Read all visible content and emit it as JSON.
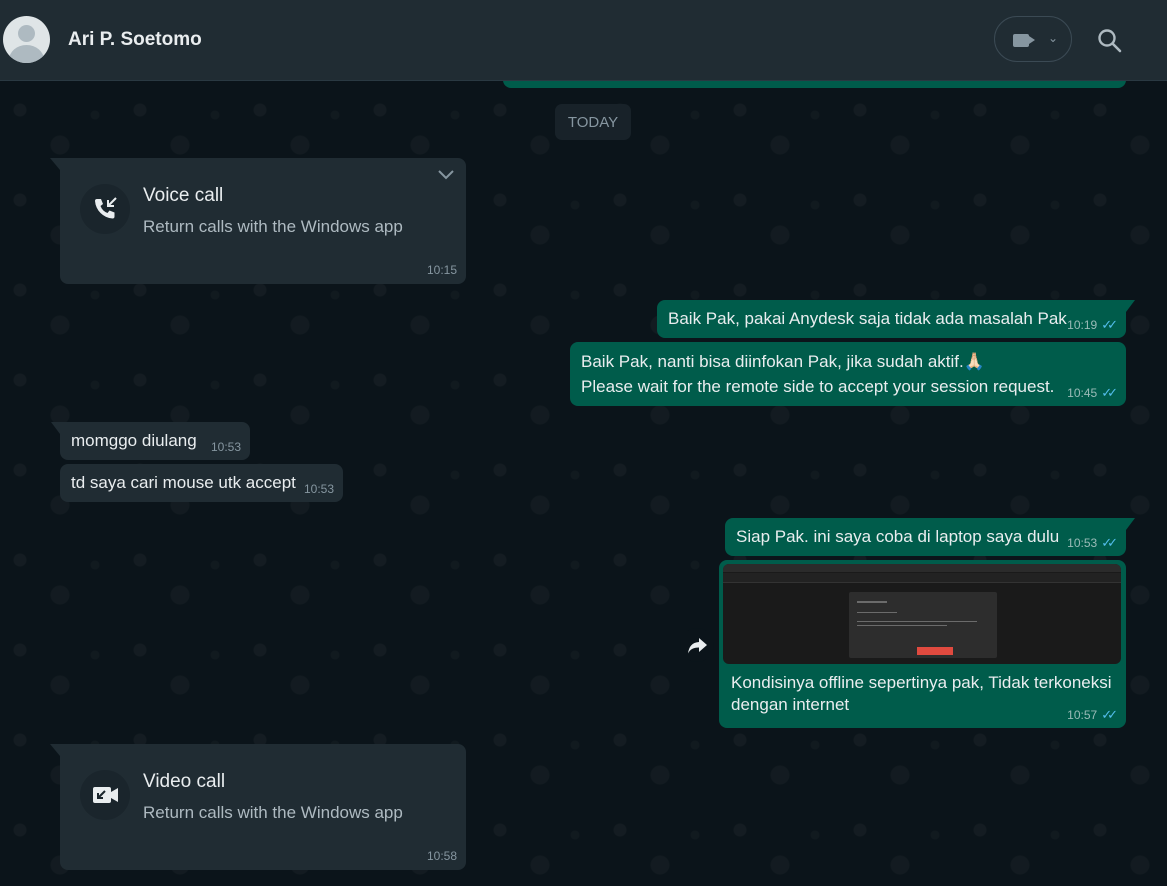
{
  "header": {
    "contact_name": "Ari P. Soetomo",
    "icons": [
      "avatar-icon",
      "video-camera-icon",
      "chevron-down-icon",
      "search-icon"
    ]
  },
  "date_chip": "TODAY",
  "voice_call": {
    "title": "Voice call",
    "subtitle": "Return calls with the Windows app",
    "time": "10:15"
  },
  "messages": [
    {
      "dir": "out",
      "lines": [
        "Baik Pak, pakai Anydesk saja tidak ada masalah Pak"
      ],
      "time": "10:19"
    },
    {
      "dir": "out",
      "lines": [
        "Baik Pak, nanti bisa diinfokan Pak, jika sudah aktif.🙏🏻",
        "Please wait for the remote side to accept your session request."
      ],
      "time": "10:45"
    },
    {
      "dir": "in",
      "lines": [
        "momggo diulang"
      ],
      "time": "10:53"
    },
    {
      "dir": "in",
      "lines": [
        "td saya cari mouse utk accept"
      ],
      "time": "10:53"
    },
    {
      "dir": "out",
      "lines": [
        "Siap Pak. ini saya coba di laptop saya dulu"
      ],
      "time": "10:53"
    },
    {
      "dir": "out",
      "lines": [
        "Kondisinya offline sepertinya pak, Tidak terkoneksi",
        "dengan internet"
      ],
      "time": "10:57"
    }
  ],
  "video_call": {
    "title": "Video call",
    "subtitle": "Return calls with the Windows app",
    "time": "10:58"
  },
  "colors": {
    "background": "#0b141a",
    "header": "#202c33",
    "outgoing_bubble": "#005c4b",
    "incoming_bubble": "#202c33",
    "read_ticks": "#53bdeb"
  }
}
